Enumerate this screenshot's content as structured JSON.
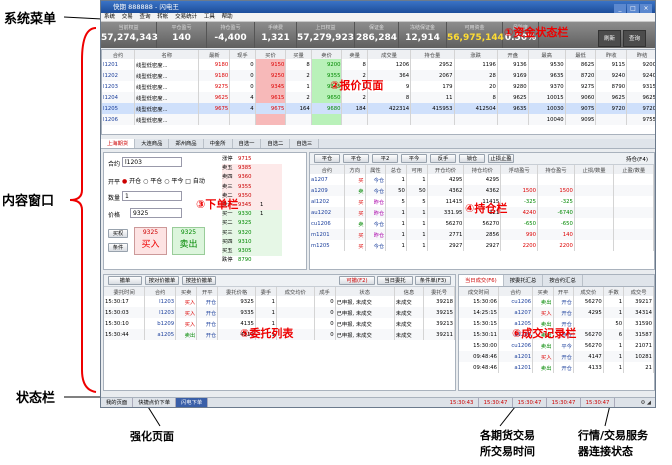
{
  "callouts": {
    "system_menu": "系统菜单",
    "content_window": "内容窗口",
    "status_bar": "状态栏",
    "enhanced_page": "强化页面",
    "exchange_time": "各期货交易\n所交易时间",
    "quote_conn": "行情/交易服务\n器连接状态"
  },
  "red_labels": {
    "fund": "①资金状态栏",
    "quote": "②报价页面",
    "order": "③下单栏",
    "position": "④持仓栏",
    "entrust": "⑤委托列表",
    "deal": "⑥成交记录栏"
  },
  "window": {
    "title": "快期 888888 - 闪电王",
    "controls": [
      "_",
      "□",
      "×"
    ],
    "menu": [
      "系统",
      "交易",
      "查询",
      "转帐",
      "交易统计",
      "工具",
      "帮助"
    ]
  },
  "fund_bar": {
    "items": [
      {
        "label": "当前权益",
        "value": "57,274,343",
        "color": "#ffffff"
      },
      {
        "label": "平仓盈亏",
        "value": "140",
        "color": "#ffffff"
      },
      {
        "label": "持仓盈亏",
        "value": "-4,400",
        "color": "#ffffff"
      },
      {
        "label": "手续费",
        "value": "1,321",
        "color": "#ffffff"
      },
      {
        "label": "上日权益",
        "value": "57,279,923",
        "color": "#ffffff"
      },
      {
        "label": "保证金",
        "value": "286,284",
        "color": "#ffffff"
      },
      {
        "label": "冻结保证金",
        "value": "12,914",
        "color": "#ffffff"
      },
      {
        "label": "可用资金",
        "value": "56,975,144",
        "color": "#ffdd33"
      },
      {
        "label": "风险度",
        "value": "0.50%",
        "color": "#ffffff"
      }
    ],
    "buttons": [
      "刷新",
      "查询"
    ]
  },
  "quotes": {
    "headers": [
      "合约",
      "名称",
      "最新",
      "现手",
      "买价",
      "买量",
      "卖价",
      "卖量",
      "成交量",
      "持仓量",
      "涨跌",
      "开盘",
      "最高",
      "最低",
      "昨收",
      "昨结"
    ],
    "rows": [
      [
        "l1201",
        "线型低密度...",
        "9180",
        "0",
        "9150",
        "8",
        "9200",
        "8",
        "1206",
        "2952",
        "1196",
        "9136",
        "9530",
        "8625",
        "9115",
        "9200",
        "9115",
        "9080",
        "9100"
      ],
      [
        "l1202",
        "线型低密度...",
        "9180",
        "0",
        "9250",
        "2",
        "9355",
        "2",
        "364",
        "2067",
        "28",
        "9169",
        "9635",
        "8720",
        "9240",
        "9240",
        "9180",
        "9100"
      ],
      [
        "l1203",
        "线型低密度...",
        "9275",
        "0",
        "9345",
        "1",
        "9345",
        "1",
        "9",
        "179",
        "20",
        "9280",
        "9370",
        "9275",
        "8790",
        "9315",
        "9345",
        "9100"
      ],
      [
        "l1204",
        "线型低密度...",
        "9625",
        "4",
        "9615",
        "2",
        "9650",
        "2",
        "8",
        "11",
        "8",
        "9625",
        "10015",
        "9060",
        "9625",
        "9625",
        "9640",
        "9505"
      ],
      [
        "l1205",
        "线型低密度...",
        "9675",
        "4",
        "9675",
        "164",
        "9680",
        "184",
        "422314",
        "415953",
        "412504",
        "9635",
        "10030",
        "9075",
        "9720",
        "9720",
        "9650",
        "9555"
      ],
      [
        "l1206",
        "线型低密度...",
        "",
        "",
        "",
        "",
        "",
        "",
        "",
        "",
        "",
        "",
        "10040",
        "9095",
        "",
        "9755",
        "9755",
        "9620"
      ]
    ]
  },
  "quote_tabs": [
    "上海期货",
    "大连商品",
    "郑州商品",
    "中金所",
    "自选一",
    "自选二",
    "自选三"
  ],
  "order": {
    "contract_label": "合约",
    "contract_value": "l1203",
    "open_label": "开平",
    "open_options": [
      "开仓",
      "平仓",
      "平今"
    ],
    "auto_label": "自动",
    "qty_label": "数量",
    "qty_value": "1",
    "price_label": "价格",
    "price_value": "9325",
    "buy_label": "买入",
    "sell_label": "卖出",
    "buy_price": "9325",
    "sell_price": "9325",
    "btn_buy_flag": "买权",
    "btn_cond": "条件",
    "ladder": [
      [
        "涨停",
        "9715",
        ""
      ],
      [
        "卖五",
        "9385",
        ""
      ],
      [
        "卖四",
        "9360",
        ""
      ],
      [
        "卖三",
        "9355",
        ""
      ],
      [
        "卖二",
        "9350",
        ""
      ],
      [
        "卖一",
        "9345",
        "1"
      ],
      [
        "买一",
        "9330",
        "1"
      ],
      [
        "买二",
        "9325",
        ""
      ],
      [
        "买三",
        "9320",
        ""
      ],
      [
        "买四",
        "9310",
        ""
      ],
      [
        "买五",
        "9305",
        ""
      ],
      [
        "跌停",
        "8790",
        ""
      ]
    ]
  },
  "position": {
    "toolbar": [
      "平仓",
      "平仓",
      "平2",
      "平今",
      "反手",
      "锁仓",
      "止损止盈"
    ],
    "toolbar_right": "持仓(F4)",
    "headers": [
      "合约",
      "方向",
      "属性",
      "总仓",
      "可用",
      "开仓均价",
      "持仓均价",
      "浮动盈亏",
      "持仓盈亏",
      "止损/数量",
      "止盈/数量"
    ],
    "rows": [
      [
        "a1207",
        "买",
        "今仓",
        "1",
        "1",
        "4295",
        "4295",
        "",
        "",
        "",
        ""
      ],
      [
        "a1209",
        "卖",
        "今仓",
        "50",
        "50",
        "4362",
        "4362",
        "1500",
        "1500",
        "",
        ""
      ],
      [
        "al1202",
        "买",
        "昨仓",
        "5",
        "5",
        "11415",
        "11415",
        "-325",
        "-325",
        "",
        ""
      ],
      [
        "au1202",
        "买",
        "昨仓",
        "1",
        "1",
        "331.95",
        "321",
        "4240",
        "-6740",
        "",
        ""
      ],
      [
        "cu1206",
        "卖",
        "今仓",
        "1",
        "1",
        "56270",
        "56270",
        "-650",
        "-650",
        "",
        ""
      ],
      [
        "m1201",
        "买",
        "昨仓",
        "1",
        "1",
        "2771",
        "2856",
        "990",
        "140",
        "",
        ""
      ],
      [
        "m1205",
        "买",
        "今仓",
        "1",
        "1",
        "2927",
        "2927",
        "2200",
        "2200",
        "",
        ""
      ]
    ]
  },
  "entrust": {
    "toolbar": [
      "撤单",
      "按对价撤单",
      "按挂价撤单"
    ],
    "tabs": [
      "可撤(F2)",
      "当日委托",
      "条件单(F3)"
    ],
    "headers": [
      "委托时间",
      "合约",
      "买卖",
      "开平",
      "委托价格",
      "委手",
      "成交均价",
      "成手",
      "状态",
      "信息",
      "委托号"
    ],
    "rows": [
      [
        "15:30:17",
        "l1203",
        "买入",
        "开仓",
        "9325",
        "1",
        "",
        "0",
        "已申报, 未成交",
        "未成交",
        "39218"
      ],
      [
        "15:30:03",
        "l1203",
        "买入",
        "开仓",
        "9335",
        "1",
        "",
        "0",
        "已申报, 未成交",
        "未成交",
        "39215"
      ],
      [
        "15:30:10",
        "b1209",
        "买入",
        "开仓",
        "4135",
        "1",
        "",
        "0",
        "已申报, 未成交",
        "未成交",
        "39213"
      ],
      [
        "15:30:44",
        "a1205",
        "卖出",
        "开仓",
        "4513",
        "1",
        "",
        "0",
        "已申报, 未成交",
        "未成交",
        "39211"
      ]
    ]
  },
  "deal": {
    "tabs": [
      "当日成交(F6)",
      "按委托汇总",
      "按合约汇总"
    ],
    "headers": [
      "成交时间",
      "合约",
      "买卖",
      "开平",
      "成交价",
      "手数",
      "成交号"
    ],
    "rows": [
      [
        "15:30:06",
        "cu1206",
        "卖出",
        "开仓",
        "56270",
        "1",
        "39217"
      ],
      [
        "14:25:15",
        "a1207",
        "买入",
        "开仓",
        "4295",
        "1",
        "34314"
      ],
      [
        "15:30:15",
        "a1205",
        "卖出",
        "开仓",
        "",
        "50",
        "31590"
      ],
      [
        "15:30:11",
        "a1205",
        "卖出",
        "开仓",
        "56270",
        "6",
        "31587"
      ],
      [
        "15:30:00",
        "cu1206",
        "卖出",
        "平今",
        "56270",
        "1",
        "21071"
      ],
      [
        "09:48:46",
        "a1201",
        "买入",
        "开仓",
        "4147",
        "1",
        "10281"
      ],
      [
        "09:48:46",
        "a1201",
        "卖出",
        "开仓",
        "4133",
        "1",
        "21"
      ]
    ]
  },
  "statusbar": {
    "tabs": [
      "我的页面",
      "快捷点价下单",
      "闪电下单"
    ],
    "times": [
      "15:30:43",
      "15:30:47",
      "15:30:47",
      "15:30:47",
      "15:30:47"
    ]
  }
}
